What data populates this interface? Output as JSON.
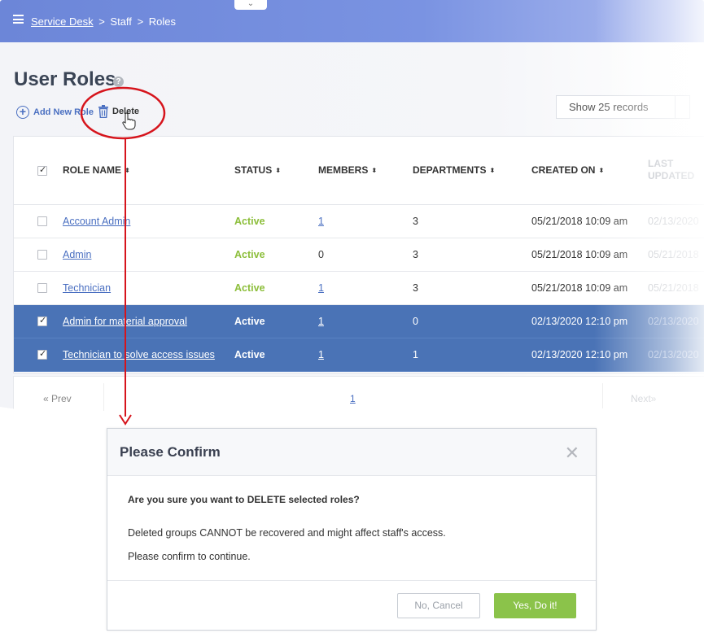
{
  "breadcrumb": {
    "root": "Service Desk",
    "sep": ">",
    "middle": "Staff",
    "current": "Roles"
  },
  "page": {
    "title": "User Roles"
  },
  "toolbar": {
    "add_label": "Add New Role",
    "delete_label": "Delete",
    "records_select": "Show 25 records"
  },
  "table": {
    "headers": {
      "role_name": "ROLE NAME",
      "status": "STATUS",
      "members": "MEMBERS",
      "departments": "DEPARTMENTS",
      "created_on": "CREATED ON",
      "last_updated_1": "LAST",
      "last_updated_2": "UPDATED"
    },
    "sort_glyph": "⬍",
    "rows": [
      {
        "checked": false,
        "name": "Account Admin",
        "status": "Active",
        "members": "1",
        "departments": "3",
        "created": "05/21/2018 10:09 am",
        "updated": "02/13/2020"
      },
      {
        "checked": false,
        "name": "Admin",
        "status": "Active",
        "members": "0",
        "departments": "3",
        "created": "05/21/2018 10:09 am",
        "updated": "05/21/2018"
      },
      {
        "checked": false,
        "name": "Technician",
        "status": "Active",
        "members": "1",
        "departments": "3",
        "created": "05/21/2018 10:09 am",
        "updated": "05/21/2018"
      },
      {
        "checked": true,
        "name": "Admin for material approval",
        "status": "Active",
        "members": "1",
        "departments": "0",
        "created": "02/13/2020 12:10 pm",
        "updated": "02/13/2020"
      },
      {
        "checked": true,
        "name": "Technician to solve access issues",
        "status": "Active",
        "members": "1",
        "departments": "1",
        "created": "02/13/2020 12:10 pm",
        "updated": "02/13/2020"
      }
    ]
  },
  "pager": {
    "prev": "« Prev",
    "page": "1",
    "next": "Next»"
  },
  "modal": {
    "title": "Please Confirm",
    "close": "✕",
    "question": "Are you sure you want to DELETE selected roles?",
    "line1": "Deleted groups CANNOT be recovered and might affect staff's access.",
    "line2": "Please confirm to continue.",
    "cancel": "No, Cancel",
    "confirm": "Yes, Do it!"
  },
  "colors": {
    "accent": "#4a73b6",
    "active": "#8cbe3a",
    "confirm": "#8bc34a",
    "annotation": "#d6141c"
  },
  "icons": [
    "menu-icon",
    "help-icon",
    "add-circle-icon",
    "trash-icon",
    "hand-cursor-icon",
    "close-icon",
    "sort-icon"
  ]
}
